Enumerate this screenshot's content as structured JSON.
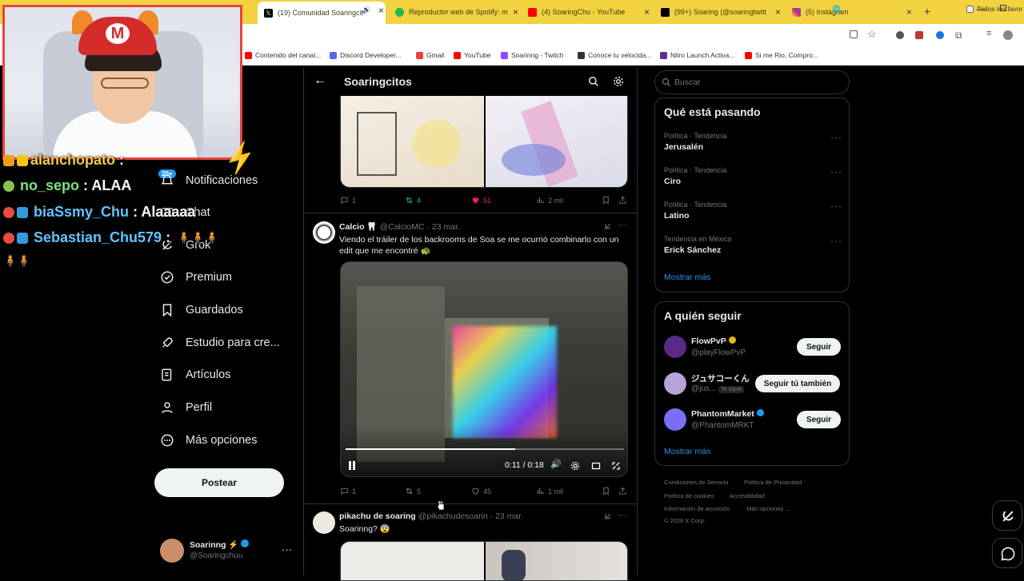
{
  "browser": {
    "tabs": [
      {
        "label": "(19) Comunidad Soaringcit",
        "color": "#000000",
        "active": true
      },
      {
        "label": "Reproductor web de Spotify: m",
        "color": "#1db954"
      },
      {
        "label": "(4) SoaringChu - YouTube",
        "color": "#ff0000"
      },
      {
        "label": "(99+) Soaring (@soaringtwitt",
        "color": "#000000"
      },
      {
        "label": "(5) Instagram",
        "color": "#d62976"
      }
    ],
    "bookmarks": [
      {
        "label": "Contenido del canal...",
        "color": "#ff0000"
      },
      {
        "label": "Discord Developer...",
        "color": "#5865f2"
      },
      {
        "label": "Gmail",
        "color": "#ea4335"
      },
      {
        "label": "YouTube",
        "color": "#ff0000"
      },
      {
        "label": "Soarinng - Twitch",
        "color": "#9146ff"
      },
      {
        "label": "Conoce tu velocida...",
        "color": "#333333"
      },
      {
        "label": "Nitro Launch Activa...",
        "color": "#5a2ca0"
      },
      {
        "label": "Si me Rio, Compro...",
        "color": "#ff0000"
      }
    ],
    "bookmarks_folder": "Todos los favor"
  },
  "chat": [
    {
      "user": "alanchopato",
      "text": ":",
      "color": "#f2c94c"
    },
    {
      "user": "no_sepo",
      "text": ": ALAA",
      "color": "#7ee07e"
    },
    {
      "user": "biaSsmy_Chu",
      "text": ": Alaaaaa",
      "color": "#62c2ff"
    },
    {
      "user": "Sebastian_Chu579",
      "text": ":",
      "color": "#62c2ff"
    }
  ],
  "nav": {
    "badge": "20+",
    "items": [
      "Notificaciones",
      "Chat",
      "Grok",
      "Premium",
      "Guardados",
      "Estudio para cre...",
      "Artículos",
      "Perfil",
      "Más opciones"
    ],
    "post_button": "Postear",
    "account_name": "Soarinng ⚡",
    "account_handle": "@Soaringchuu"
  },
  "timeline": {
    "title": "Soaringcitos",
    "post1_stats": {
      "replies": "1",
      "reposts": "4",
      "likes": "51",
      "views": "2 mil"
    },
    "post2": {
      "name": "Calcio 🦷",
      "handle": "@CalcioMC · 23 mar.",
      "text_line1": "Viendo el tráiler de los backrooms de Soa se me ocurrió combinarlo con un",
      "text_line2": "edit que me encontré 🐢",
      "video_time": "0:11 / 0:18",
      "video_progress": 0.61,
      "stats": {
        "replies": "1",
        "reposts": "5",
        "likes": "45",
        "views": "1 mil"
      }
    },
    "post3": {
      "name": "pikachu de soaring",
      "handle": "@pikachudesoarin · 23 mar.",
      "text": "Soarinng? 😨"
    }
  },
  "right": {
    "search_placeholder": "Buscar",
    "trends_title": "Qué está pasando",
    "trends": [
      {
        "category": "Política · Tendencia",
        "name": "Jerusalén"
      },
      {
        "category": "Política · Tendencia",
        "name": "Ciro"
      },
      {
        "category": "Política · Tendencia",
        "name": "Latino"
      },
      {
        "category": "Tendencia en México",
        "name": "Erick Sánchez"
      }
    ],
    "show_more": "Mostrar más",
    "follow_title": "A quién seguir",
    "suggestions": [
      {
        "name": "FlowPvP",
        "handle": "@playFlowPvP",
        "button": "Seguir",
        "avatar_color": "#5b2a86"
      },
      {
        "name": "ジュサコーくん",
        "handle": "@jus...",
        "follows_you": "Te sigue",
        "button": "Seguir tú también",
        "avatar_color": "#b7a4d8"
      },
      {
        "name": "PhantomMarket",
        "handle": "@PhantomMRKT",
        "button": "Seguir",
        "avatar_color": "#7b6ef6"
      }
    ],
    "footer": [
      "Condiciones de Servicio",
      "Política de Privacidad",
      "Política de cookies",
      "Accesibilidad",
      "Información de anuncios",
      "Más opciones ...",
      "© 2026 X Corp."
    ]
  },
  "colors": {
    "accent": "#1d9bf0",
    "like": "#f91880",
    "repost": "#00ba7c",
    "webcam_border": "#e8433f",
    "tabbar": "#f3d23f"
  }
}
